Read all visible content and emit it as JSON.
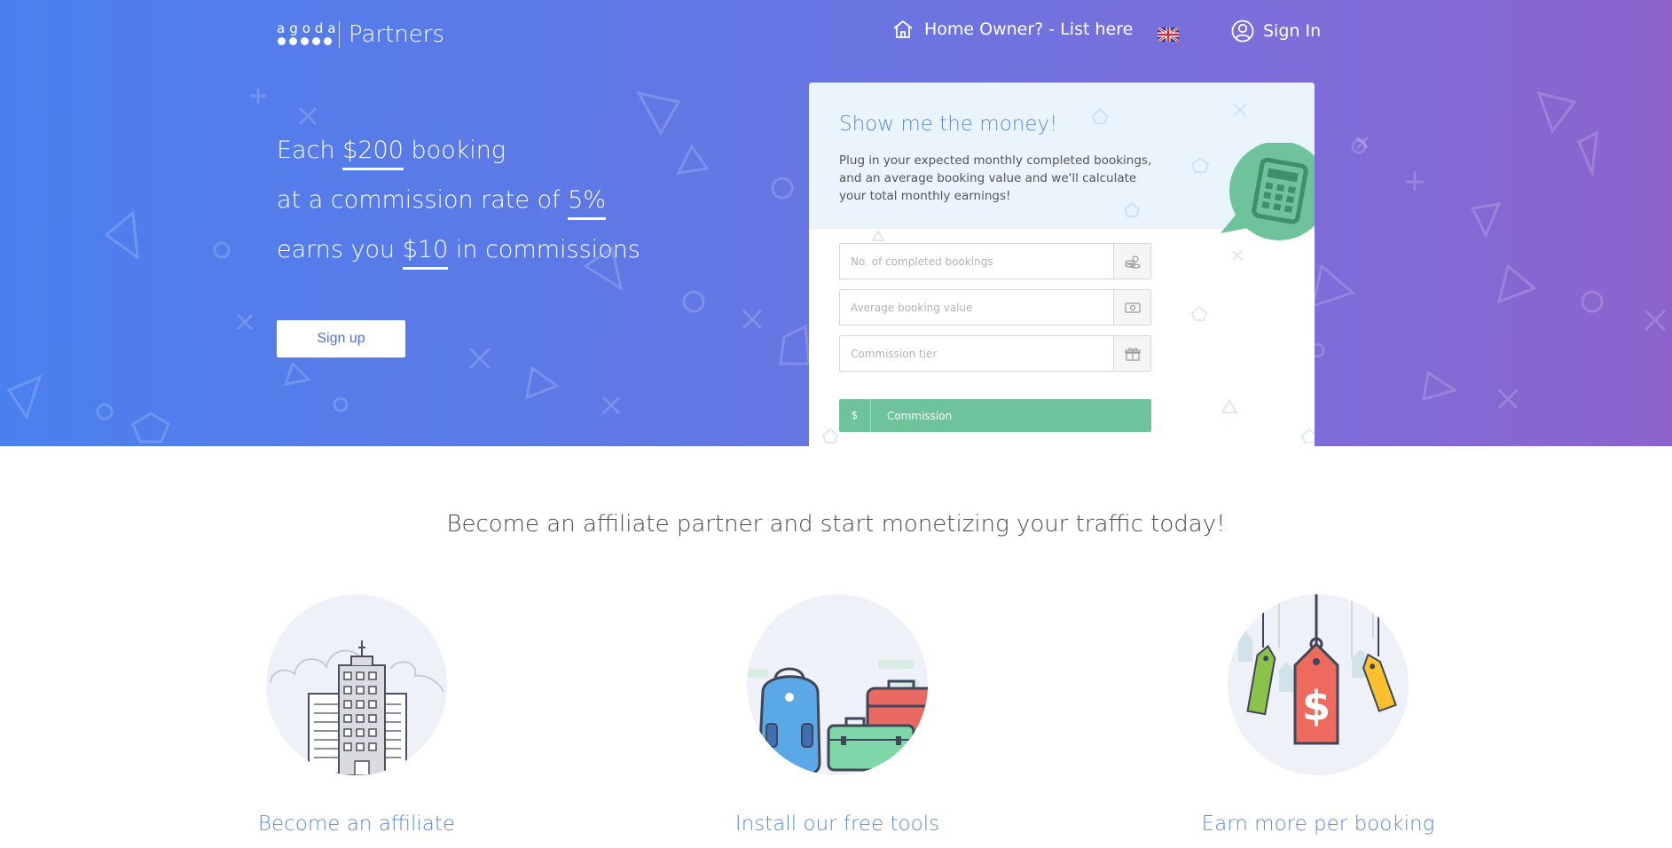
{
  "header": {
    "logo_word": "agoda",
    "logo_text": "Partners",
    "home_owner_link": "Home Owner? - List here",
    "sign_in_label": "Sign In"
  },
  "hero": {
    "line1_pre": "Each ",
    "line1_hl": "$200",
    "line1_post": " booking",
    "line2_pre": "at a commission rate of ",
    "line2_hl": "5%",
    "line3_pre": "earns you ",
    "line3_hl": "$10",
    "line3_post": " in commissions",
    "signup_label": "Sign up"
  },
  "calculator": {
    "title": "Show me the money!",
    "description": "Plug in your expected monthly completed bookings, and an average booking value and we'll calculate your total monthly earnings!",
    "bookings_placeholder": "No. of completed bookings",
    "value_placeholder": "Average booking value",
    "tier_placeholder": "Commission tier",
    "currency_symbol": "$",
    "commission_label": "Commission"
  },
  "section": {
    "title": "Become an affiliate partner and start monetizing your traffic today!",
    "features": [
      {
        "title": "Become an affiliate",
        "icon": "building-icon"
      },
      {
        "title": "Install our free tools",
        "icon": "luggage-icon"
      },
      {
        "title": "Earn more per booking",
        "icon": "price-tag-icon"
      }
    ]
  },
  "colors": {
    "hero_start": "#4a80ee",
    "hero_end": "#8c63cc",
    "accent_blue": "#5b8ad6",
    "commission_green": "#6ec39a"
  }
}
